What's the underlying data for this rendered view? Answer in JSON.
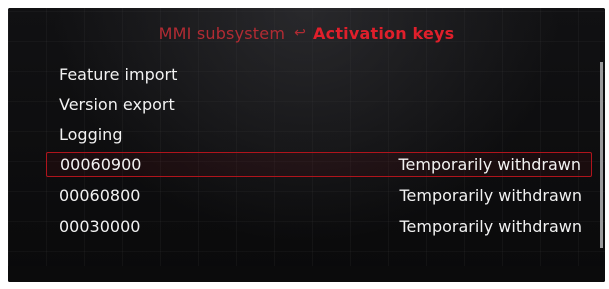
{
  "header": {
    "parent": "MMI subsystem",
    "separator_icon": "return-arrow-icon",
    "current": "Activation keys"
  },
  "menu": {
    "items": [
      {
        "label": "Feature import",
        "status": ""
      },
      {
        "label": "Version export",
        "status": ""
      },
      {
        "label": "Logging",
        "status": ""
      },
      {
        "label": "00060900",
        "status": "Temporarily withdrawn",
        "selected": true
      },
      {
        "label": "00060800",
        "status": "Temporarily withdrawn"
      },
      {
        "label": "00030000",
        "status": "Temporarily withdrawn"
      }
    ]
  },
  "colors": {
    "accent": "#e01f2b",
    "selection_border": "#b0141c",
    "text": "#f2f2f2",
    "background": "#0c0c0d"
  }
}
